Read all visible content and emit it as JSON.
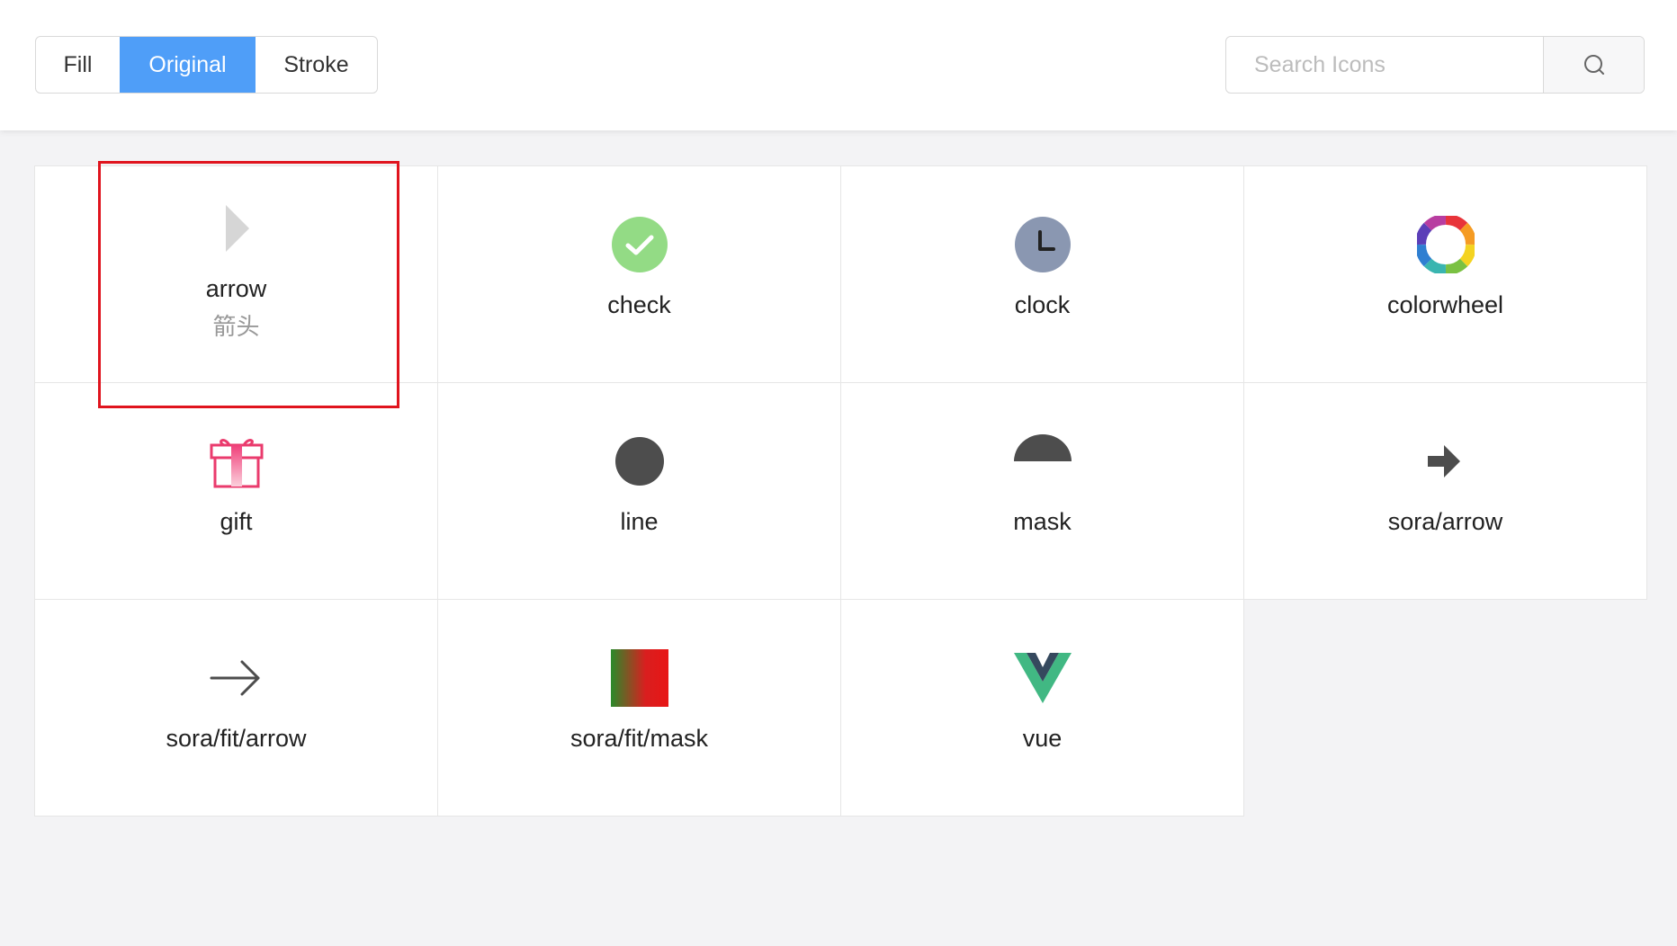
{
  "tabs": [
    {
      "label": "Fill",
      "active": false
    },
    {
      "label": "Original",
      "active": true
    },
    {
      "label": "Stroke",
      "active": false
    }
  ],
  "search": {
    "placeholder": "Search Icons",
    "button_icon": "search-icon"
  },
  "icons": [
    {
      "name": "arrow",
      "subtitle": "箭头",
      "icon": "arrow-icon"
    },
    {
      "name": "check",
      "icon": "check-icon"
    },
    {
      "name": "clock",
      "icon": "clock-icon"
    },
    {
      "name": "colorwheel",
      "icon": "colorwheel-icon"
    },
    {
      "name": "gift",
      "icon": "gift-icon"
    },
    {
      "name": "line",
      "icon": "line-icon"
    },
    {
      "name": "mask",
      "icon": "mask-icon"
    },
    {
      "name": "sora/arrow",
      "icon": "sora-arrow-icon"
    },
    {
      "name": "sora/fit/arrow",
      "icon": "sora-fit-arrow-icon"
    },
    {
      "name": "sora/fit/mask",
      "icon": "sora-fit-mask-icon"
    },
    {
      "name": "vue",
      "icon": "vue-icon"
    }
  ],
  "colors": {
    "accent": "#4f9ef8",
    "highlight": "#e0141e"
  }
}
